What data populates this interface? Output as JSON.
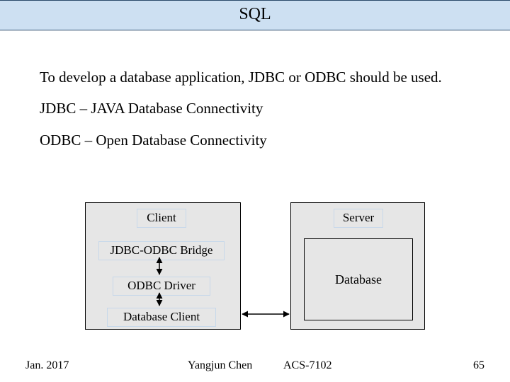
{
  "title": "SQL",
  "body": {
    "p1": "To develop a database application, JDBC or ODBC should be used.",
    "p2": "JDBC – JAVA Database Connectivity",
    "p3": "ODBC – Open Database Connectivity"
  },
  "diagram": {
    "client_label": "Client",
    "jdbc_odbc_bridge": "JDBC-ODBC Bridge",
    "odbc_driver": "ODBC Driver",
    "database_client": "Database Client",
    "server_label": "Server",
    "database": "Database"
  },
  "footer": {
    "date": "Jan. 2017",
    "author": "Yangjun Chen",
    "course": "ACS-7102",
    "page": "65"
  }
}
